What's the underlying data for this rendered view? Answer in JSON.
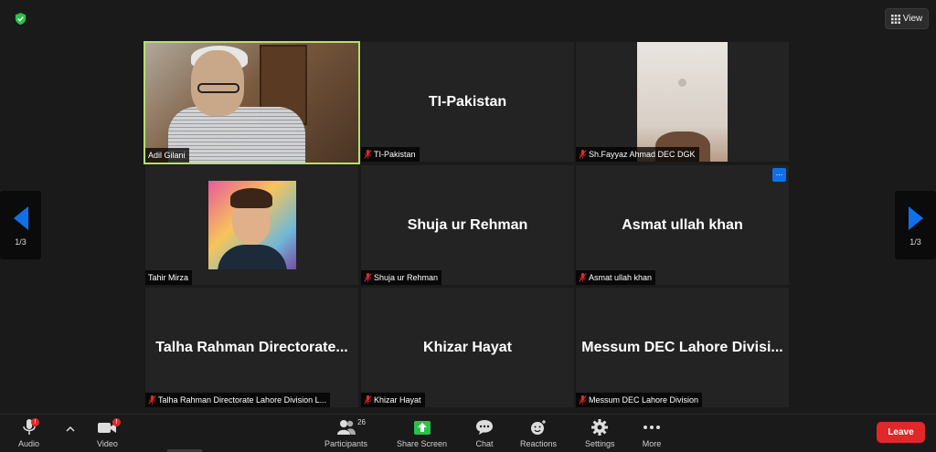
{
  "colors": {
    "background": "#1a1a1a",
    "tile": "#232323",
    "active_speaker_border": "#b8de6f",
    "accent_blue": "#0e71eb",
    "leave_red": "#e02828",
    "shield_green": "#27c24c"
  },
  "header": {
    "security_icon": "shield-check-icon",
    "view_label": "View"
  },
  "pagination": {
    "left_page": "1/3",
    "right_page": "1/3"
  },
  "participants": [
    {
      "name": "Adil Gilani",
      "display_title": "",
      "muted": false,
      "video": true
    },
    {
      "name": "TI-Pakistan",
      "display_title": "TI-Pakistan",
      "muted": true,
      "video": false
    },
    {
      "name": "Sh.Fayyaz Ahmad DEC DGK",
      "display_title": "",
      "muted": true,
      "video": true
    },
    {
      "name": "Tahir Mirza",
      "display_title": "",
      "muted": false,
      "video": false
    },
    {
      "name": "Shuja ur Rehman",
      "display_title": "Shuja ur Rehman",
      "muted": true,
      "video": false
    },
    {
      "name": "Asmat ullah khan",
      "display_title": "Asmat ullah khan",
      "muted": true,
      "video": false
    },
    {
      "name": "Talha Rahman Directorate Lahore Division L...",
      "display_title": "Talha Rahman Directorate...",
      "muted": true,
      "video": false
    },
    {
      "name": "Khizar Hayat",
      "display_title": "Khizar Hayat",
      "muted": true,
      "video": false
    },
    {
      "name": "Messum DEC Lahore Division",
      "display_title": "Messum DEC Lahore Divisi...",
      "muted": true,
      "video": false
    }
  ],
  "tile_more_label": "...",
  "toolbar": {
    "audio": {
      "label": "Audio",
      "badge": "!"
    },
    "video": {
      "label": "Video",
      "badge": "!"
    },
    "participants": {
      "label": "Participants",
      "count": "26"
    },
    "share": {
      "label": "Share Screen"
    },
    "chat": {
      "label": "Chat"
    },
    "reactions": {
      "label": "Reactions"
    },
    "settings": {
      "label": "Settings"
    },
    "more": {
      "label": "More"
    },
    "leave": {
      "label": "Leave"
    }
  }
}
